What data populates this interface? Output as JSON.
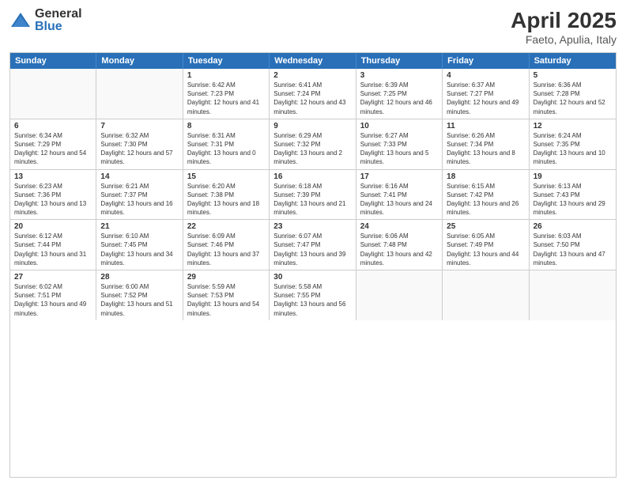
{
  "logo": {
    "general": "General",
    "blue": "Blue"
  },
  "title": {
    "month": "April 2025",
    "location": "Faeto, Apulia, Italy"
  },
  "weekdays": [
    "Sunday",
    "Monday",
    "Tuesday",
    "Wednesday",
    "Thursday",
    "Friday",
    "Saturday"
  ],
  "weeks": [
    [
      {
        "num": "",
        "sunrise": "",
        "sunset": "",
        "daylight": ""
      },
      {
        "num": "",
        "sunrise": "",
        "sunset": "",
        "daylight": ""
      },
      {
        "num": "1",
        "sunrise": "Sunrise: 6:42 AM",
        "sunset": "Sunset: 7:23 PM",
        "daylight": "Daylight: 12 hours and 41 minutes."
      },
      {
        "num": "2",
        "sunrise": "Sunrise: 6:41 AM",
        "sunset": "Sunset: 7:24 PM",
        "daylight": "Daylight: 12 hours and 43 minutes."
      },
      {
        "num": "3",
        "sunrise": "Sunrise: 6:39 AM",
        "sunset": "Sunset: 7:25 PM",
        "daylight": "Daylight: 12 hours and 46 minutes."
      },
      {
        "num": "4",
        "sunrise": "Sunrise: 6:37 AM",
        "sunset": "Sunset: 7:27 PM",
        "daylight": "Daylight: 12 hours and 49 minutes."
      },
      {
        "num": "5",
        "sunrise": "Sunrise: 6:36 AM",
        "sunset": "Sunset: 7:28 PM",
        "daylight": "Daylight: 12 hours and 52 minutes."
      }
    ],
    [
      {
        "num": "6",
        "sunrise": "Sunrise: 6:34 AM",
        "sunset": "Sunset: 7:29 PM",
        "daylight": "Daylight: 12 hours and 54 minutes."
      },
      {
        "num": "7",
        "sunrise": "Sunrise: 6:32 AM",
        "sunset": "Sunset: 7:30 PM",
        "daylight": "Daylight: 12 hours and 57 minutes."
      },
      {
        "num": "8",
        "sunrise": "Sunrise: 6:31 AM",
        "sunset": "Sunset: 7:31 PM",
        "daylight": "Daylight: 13 hours and 0 minutes."
      },
      {
        "num": "9",
        "sunrise": "Sunrise: 6:29 AM",
        "sunset": "Sunset: 7:32 PM",
        "daylight": "Daylight: 13 hours and 2 minutes."
      },
      {
        "num": "10",
        "sunrise": "Sunrise: 6:27 AM",
        "sunset": "Sunset: 7:33 PM",
        "daylight": "Daylight: 13 hours and 5 minutes."
      },
      {
        "num": "11",
        "sunrise": "Sunrise: 6:26 AM",
        "sunset": "Sunset: 7:34 PM",
        "daylight": "Daylight: 13 hours and 8 minutes."
      },
      {
        "num": "12",
        "sunrise": "Sunrise: 6:24 AM",
        "sunset": "Sunset: 7:35 PM",
        "daylight": "Daylight: 13 hours and 10 minutes."
      }
    ],
    [
      {
        "num": "13",
        "sunrise": "Sunrise: 6:23 AM",
        "sunset": "Sunset: 7:36 PM",
        "daylight": "Daylight: 13 hours and 13 minutes."
      },
      {
        "num": "14",
        "sunrise": "Sunrise: 6:21 AM",
        "sunset": "Sunset: 7:37 PM",
        "daylight": "Daylight: 13 hours and 16 minutes."
      },
      {
        "num": "15",
        "sunrise": "Sunrise: 6:20 AM",
        "sunset": "Sunset: 7:38 PM",
        "daylight": "Daylight: 13 hours and 18 minutes."
      },
      {
        "num": "16",
        "sunrise": "Sunrise: 6:18 AM",
        "sunset": "Sunset: 7:39 PM",
        "daylight": "Daylight: 13 hours and 21 minutes."
      },
      {
        "num": "17",
        "sunrise": "Sunrise: 6:16 AM",
        "sunset": "Sunset: 7:41 PM",
        "daylight": "Daylight: 13 hours and 24 minutes."
      },
      {
        "num": "18",
        "sunrise": "Sunrise: 6:15 AM",
        "sunset": "Sunset: 7:42 PM",
        "daylight": "Daylight: 13 hours and 26 minutes."
      },
      {
        "num": "19",
        "sunrise": "Sunrise: 6:13 AM",
        "sunset": "Sunset: 7:43 PM",
        "daylight": "Daylight: 13 hours and 29 minutes."
      }
    ],
    [
      {
        "num": "20",
        "sunrise": "Sunrise: 6:12 AM",
        "sunset": "Sunset: 7:44 PM",
        "daylight": "Daylight: 13 hours and 31 minutes."
      },
      {
        "num": "21",
        "sunrise": "Sunrise: 6:10 AM",
        "sunset": "Sunset: 7:45 PM",
        "daylight": "Daylight: 13 hours and 34 minutes."
      },
      {
        "num": "22",
        "sunrise": "Sunrise: 6:09 AM",
        "sunset": "Sunset: 7:46 PM",
        "daylight": "Daylight: 13 hours and 37 minutes."
      },
      {
        "num": "23",
        "sunrise": "Sunrise: 6:07 AM",
        "sunset": "Sunset: 7:47 PM",
        "daylight": "Daylight: 13 hours and 39 minutes."
      },
      {
        "num": "24",
        "sunrise": "Sunrise: 6:06 AM",
        "sunset": "Sunset: 7:48 PM",
        "daylight": "Daylight: 13 hours and 42 minutes."
      },
      {
        "num": "25",
        "sunrise": "Sunrise: 6:05 AM",
        "sunset": "Sunset: 7:49 PM",
        "daylight": "Daylight: 13 hours and 44 minutes."
      },
      {
        "num": "26",
        "sunrise": "Sunrise: 6:03 AM",
        "sunset": "Sunset: 7:50 PM",
        "daylight": "Daylight: 13 hours and 47 minutes."
      }
    ],
    [
      {
        "num": "27",
        "sunrise": "Sunrise: 6:02 AM",
        "sunset": "Sunset: 7:51 PM",
        "daylight": "Daylight: 13 hours and 49 minutes."
      },
      {
        "num": "28",
        "sunrise": "Sunrise: 6:00 AM",
        "sunset": "Sunset: 7:52 PM",
        "daylight": "Daylight: 13 hours and 51 minutes."
      },
      {
        "num": "29",
        "sunrise": "Sunrise: 5:59 AM",
        "sunset": "Sunset: 7:53 PM",
        "daylight": "Daylight: 13 hours and 54 minutes."
      },
      {
        "num": "30",
        "sunrise": "Sunrise: 5:58 AM",
        "sunset": "Sunset: 7:55 PM",
        "daylight": "Daylight: 13 hours and 56 minutes."
      },
      {
        "num": "",
        "sunrise": "",
        "sunset": "",
        "daylight": ""
      },
      {
        "num": "",
        "sunrise": "",
        "sunset": "",
        "daylight": ""
      },
      {
        "num": "",
        "sunrise": "",
        "sunset": "",
        "daylight": ""
      }
    ]
  ]
}
